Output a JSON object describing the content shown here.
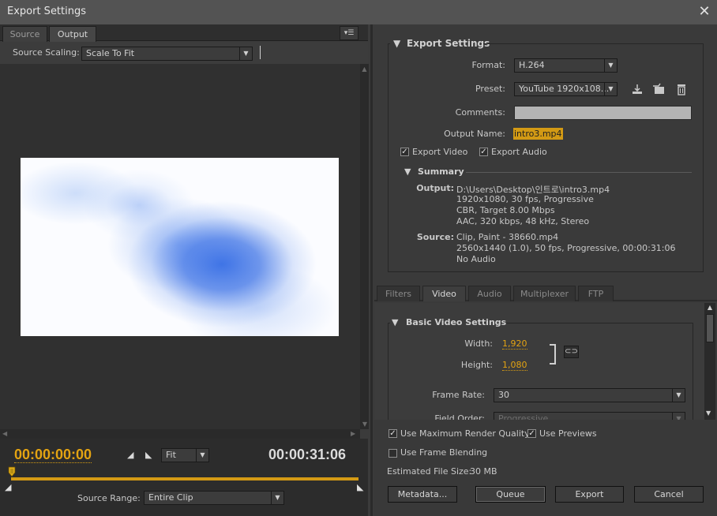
{
  "window": {
    "title": "Export Settings",
    "close_glyph": "✕"
  },
  "left_panel": {
    "tabs": [
      {
        "label": "Source"
      },
      {
        "label": "Output"
      }
    ],
    "menu_icon": "panel-menu-icon",
    "source_scaling": {
      "label": "Source Scaling:",
      "value": "Scale To Fit"
    },
    "timeline": {
      "current_time": "00:00:00:00",
      "duration": "00:00:31:06",
      "zoom": "Fit",
      "source_range_label": "Source Range:",
      "source_range_value": "Entire Clip"
    }
  },
  "export_settings": {
    "section_title": "Export Settings",
    "format_label": "Format:",
    "format_value": "H.264",
    "preset_label": "Preset:",
    "preset_value": "YouTube 1920x108...",
    "comments_label": "Comments:",
    "comments_value": "",
    "output_name_label": "Output Name:",
    "output_name_value": "intro3.mp4",
    "export_video_label": "Export Video",
    "export_video_checked": true,
    "export_audio_label": "Export Audio",
    "export_audio_checked": true
  },
  "summary": {
    "title": "Summary",
    "output_label": "Output:",
    "output_lines": [
      "D:\\Users\\Desktop\\인트로\\intro3.mp4",
      "1920x1080, 30 fps, Progressive",
      "CBR, Target 8.00 Mbps",
      "AAC, 320 kbps, 48 kHz, Stereo"
    ],
    "source_label": "Source:",
    "source_lines": [
      "Clip, Paint - 38660.mp4",
      "2560x1440 (1.0), 50 fps, Progressive, 00:00:31:06",
      "No Audio"
    ]
  },
  "settings_tabs": [
    {
      "label": "Filters"
    },
    {
      "label": "Video"
    },
    {
      "label": "Audio"
    },
    {
      "label": "Multiplexer"
    },
    {
      "label": "FTP"
    }
  ],
  "basic_video": {
    "title": "Basic Video Settings",
    "width_label": "Width:",
    "width_value": "1,920",
    "height_label": "Height:",
    "height_value": "1,080",
    "frame_rate_label": "Frame Rate:",
    "frame_rate_value": "30",
    "field_order_label": "Field Order:",
    "field_order_value": "Progressive"
  },
  "bottom": {
    "max_render_label": "Use Maximum Render Quality",
    "max_render_checked": true,
    "use_previews_label": "Use Previews",
    "use_previews_checked": true,
    "frame_blending_label": "Use Frame Blending",
    "frame_blending_checked": false,
    "file_size_label": "Estimated File Size:",
    "file_size_value": "30 MB",
    "buttons": {
      "metadata": "Metadata...",
      "queue": "Queue",
      "export": "Export",
      "cancel": "Cancel"
    }
  },
  "colors": {
    "accent_orange": "#d39a14",
    "panel_bg": "#3a3a3a",
    "titlebar_bg": "#535353"
  }
}
